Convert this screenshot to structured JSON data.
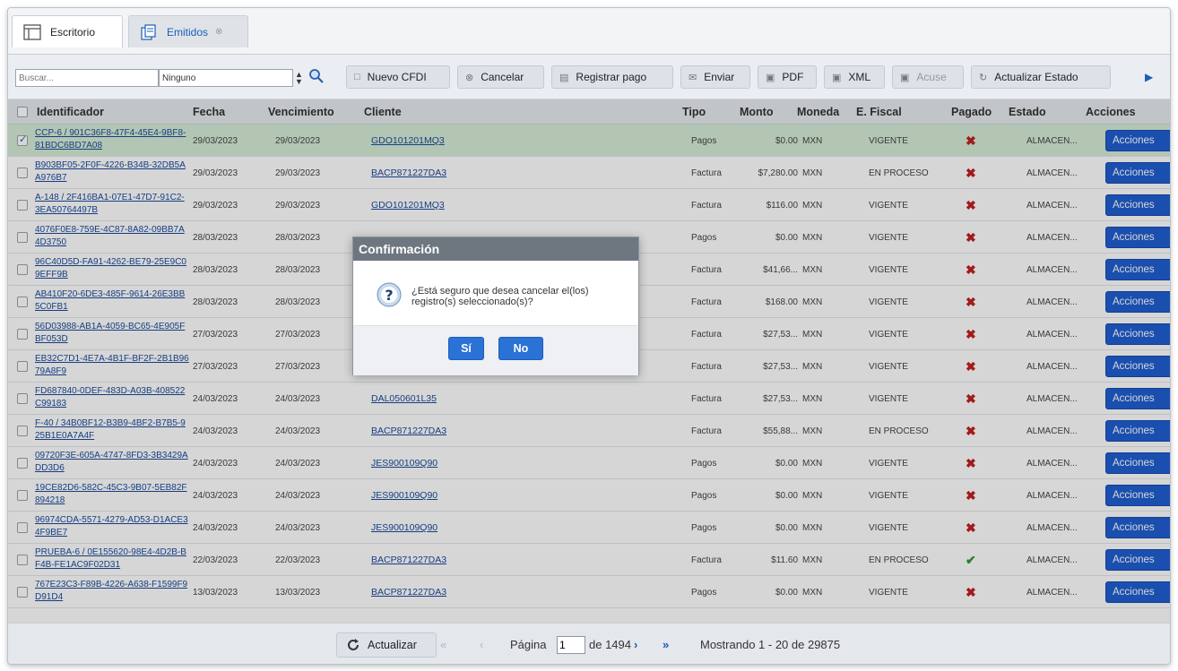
{
  "tabs": {
    "escritorio": "Escritorio",
    "emitidos": "Emitidos",
    "close_glyph": "⊗"
  },
  "toolbar": {
    "search_placeholder": "Buscar...",
    "filter_value": "Ninguno",
    "nuevo": "Nuevo CFDI",
    "cancelar": "Cancelar",
    "registrar": "Registrar pago",
    "enviar": "Enviar",
    "pdf": "PDF",
    "xml": "XML",
    "acuse": "Acuse",
    "actualizar_estado": "Actualizar Estado"
  },
  "columns": {
    "identificador": "Identificador",
    "fecha": "Fecha",
    "vencimiento": "Vencimiento",
    "cliente": "Cliente",
    "tipo": "Tipo",
    "monto": "Monto",
    "moneda": "Moneda",
    "fiscal": "E. Fiscal",
    "pagado": "Pagado",
    "estado": "Estado",
    "acciones": "Acciones"
  },
  "rows": [
    {
      "id": "CCP-6 / 901C36F8-47F4-45E4-9BF8-81BDC6BD7A08",
      "fecha": "29/03/2023",
      "venc": "29/03/2023",
      "cliente": "GDO101201MQ3",
      "tipo": "Pagos",
      "monto": "$0.00",
      "moneda": "MXN",
      "fiscal": "VIGENTE",
      "pagado": false,
      "estado": "ALMACEN...",
      "accion": "Acciones",
      "selected": true
    },
    {
      "id": "B903BF05-2F0F-4226-B34B-32DB5AA976B7",
      "fecha": "29/03/2023",
      "venc": "29/03/2023",
      "cliente": "BACP871227DA3",
      "tipo": "Factura",
      "monto": "$7,280.00",
      "moneda": "MXN",
      "fiscal": "EN PROCESO",
      "pagado": false,
      "estado": "ALMACEN...",
      "accion": "Acciones",
      "selected": false
    },
    {
      "id": "A-148 / 2F416BA1-07E1-47D7-91C2-3EA50764497B",
      "fecha": "29/03/2023",
      "venc": "29/03/2023",
      "cliente": "GDO101201MQ3",
      "tipo": "Factura",
      "monto": "$116.00",
      "moneda": "MXN",
      "fiscal": "VIGENTE",
      "pagado": false,
      "estado": "ALMACEN...",
      "accion": "Acciones",
      "selected": false
    },
    {
      "id": "4076F0E8-759E-4C87-8A82-09BB7A4D3750",
      "fecha": "28/03/2023",
      "venc": "28/03/2023",
      "cliente": "",
      "tipo": "Pagos",
      "monto": "$0.00",
      "moneda": "MXN",
      "fiscal": "VIGENTE",
      "pagado": false,
      "estado": "ALMACEN...",
      "accion": "Acciones",
      "selected": false
    },
    {
      "id": "96C40D5D-FA91-4262-BE79-25E9C09EFF9B",
      "fecha": "28/03/2023",
      "venc": "28/03/2023",
      "cliente": "",
      "tipo": "Factura",
      "monto": "$41,66...",
      "moneda": "MXN",
      "fiscal": "VIGENTE",
      "pagado": false,
      "estado": "ALMACEN...",
      "accion": "Acciones",
      "selected": false
    },
    {
      "id": "AB410F20-6DE3-485F-9614-26E3BB5C0FB1",
      "fecha": "28/03/2023",
      "venc": "28/03/2023",
      "cliente": "",
      "tipo": "Factura",
      "monto": "$168.00",
      "moneda": "MXN",
      "fiscal": "VIGENTE",
      "pagado": false,
      "estado": "ALMACEN...",
      "accion": "Acciones",
      "selected": false
    },
    {
      "id": "56D03988-AB1A-4059-BC65-4E905FBF053D",
      "fecha": "27/03/2023",
      "venc": "27/03/2023",
      "cliente": "",
      "tipo": "Factura",
      "monto": "$27,53...",
      "moneda": "MXN",
      "fiscal": "VIGENTE",
      "pagado": false,
      "estado": "ALMACEN...",
      "accion": "Acciones",
      "selected": false
    },
    {
      "id": "EB32C7D1-4E7A-4B1F-BF2F-2B1B9679A8F9",
      "fecha": "27/03/2023",
      "venc": "27/03/2023",
      "cliente": "",
      "tipo": "Factura",
      "monto": "$27,53...",
      "moneda": "MXN",
      "fiscal": "VIGENTE",
      "pagado": false,
      "estado": "ALMACEN...",
      "accion": "Acciones",
      "selected": false
    },
    {
      "id": "FD687840-0DEF-483D-A03B-408522C99183",
      "fecha": "24/03/2023",
      "venc": "24/03/2023",
      "cliente": "DAL050601L35",
      "tipo": "Factura",
      "monto": "$27,53...",
      "moneda": "MXN",
      "fiscal": "VIGENTE",
      "pagado": false,
      "estado": "ALMACEN...",
      "accion": "Acciones",
      "selected": false
    },
    {
      "id": "F-40 / 34B0BF12-B3B9-4BF2-B7B5-925B1E0A7A4F",
      "fecha": "24/03/2023",
      "venc": "24/03/2023",
      "cliente": "BACP871227DA3",
      "tipo": "Factura",
      "monto": "$55,88...",
      "moneda": "MXN",
      "fiscal": "EN PROCESO",
      "pagado": false,
      "estado": "ALMACEN...",
      "accion": "Acciones",
      "selected": false
    },
    {
      "id": "09720F3E-605A-4747-8FD3-3B3429ADD3D6",
      "fecha": "24/03/2023",
      "venc": "24/03/2023",
      "cliente": "JES900109Q90",
      "tipo": "Pagos",
      "monto": "$0.00",
      "moneda": "MXN",
      "fiscal": "VIGENTE",
      "pagado": false,
      "estado": "ALMACEN...",
      "accion": "Acciones",
      "selected": false
    },
    {
      "id": "19CE82D6-582C-45C3-9B07-5EB82F894218",
      "fecha": "24/03/2023",
      "venc": "24/03/2023",
      "cliente": "JES900109Q90",
      "tipo": "Pagos",
      "monto": "$0.00",
      "moneda": "MXN",
      "fiscal": "VIGENTE",
      "pagado": false,
      "estado": "ALMACEN...",
      "accion": "Acciones",
      "selected": false
    },
    {
      "id": "96974CDA-5571-4279-AD53-D1ACE34F9BE7",
      "fecha": "24/03/2023",
      "venc": "24/03/2023",
      "cliente": "JES900109Q90",
      "tipo": "Pagos",
      "monto": "$0.00",
      "moneda": "MXN",
      "fiscal": "VIGENTE",
      "pagado": false,
      "estado": "ALMACEN...",
      "accion": "Acciones",
      "selected": false
    },
    {
      "id": "PRUEBA-6 / 0E155620-98E4-4D2B-BF4B-FE1AC9F02D31",
      "fecha": "22/03/2023",
      "venc": "22/03/2023",
      "cliente": "BACP871227DA3",
      "tipo": "Factura",
      "monto": "$11.60",
      "moneda": "MXN",
      "fiscal": "EN PROCESO",
      "pagado": true,
      "estado": "ALMACEN...",
      "accion": "Acciones",
      "selected": false
    },
    {
      "id": "767E23C3-F89B-4226-A638-F1599F9D91D4",
      "fecha": "13/03/2023",
      "venc": "13/03/2023",
      "cliente": "BACP871227DA3",
      "tipo": "Pagos",
      "monto": "$0.00",
      "moneda": "MXN",
      "fiscal": "VIGENTE",
      "pagado": false,
      "estado": "ALMACEN...",
      "accion": "Acciones",
      "selected": false
    }
  ],
  "footer": {
    "refresh": "Actualizar",
    "page_label": "Página",
    "page_value": "1",
    "of_pages": "de 1494",
    "showing": "Mostrando 1 - 20 de 29875"
  },
  "dialog": {
    "title": "Confirmación",
    "message": "¿Está seguro que desea cancelar el(los) registro(s) seleccionado(s)?",
    "yes": "Sí",
    "no": "No"
  },
  "colors": {
    "accent": "#1f5fd1",
    "selected_row": "#d6ecd6",
    "dialog_title": "#6e7680"
  }
}
